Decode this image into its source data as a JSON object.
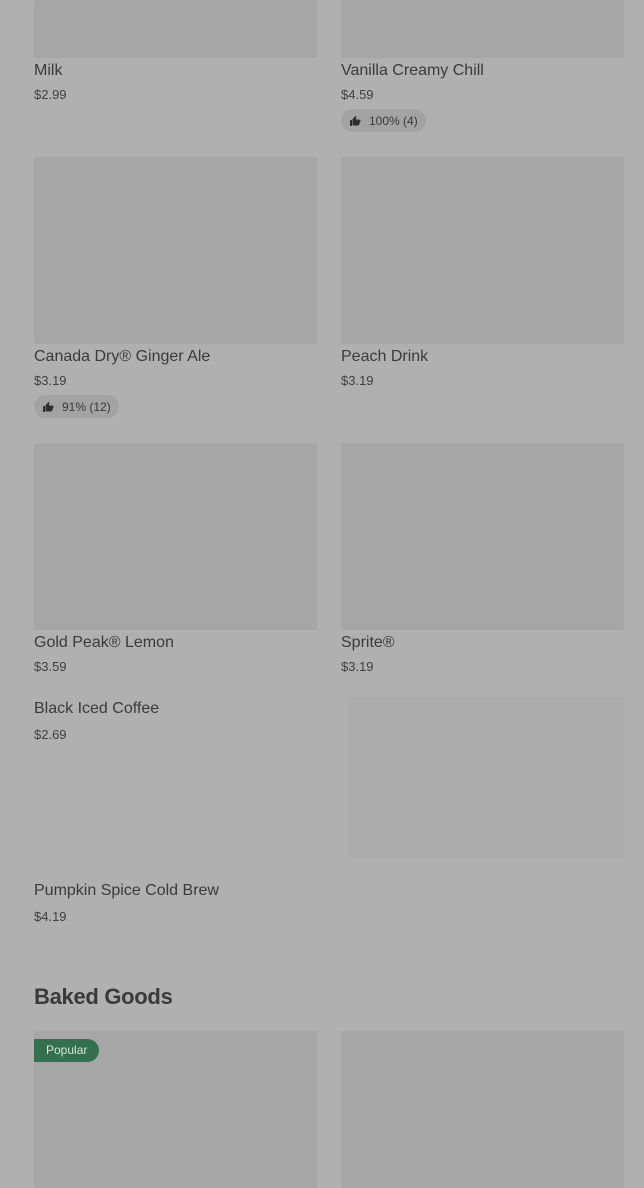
{
  "items": [
    {
      "name": "Milk",
      "price": "$2.99"
    },
    {
      "name": "Vanilla Creamy Chill",
      "price": "$4.59",
      "rating": "100% (4)"
    },
    {
      "name": "Canada Dry® Ginger Ale",
      "price": "$3.19",
      "rating": "91% (12)"
    },
    {
      "name": "Peach Drink",
      "price": "$3.19"
    },
    {
      "name": "Gold Peak® Lemon",
      "price": "$3.59"
    },
    {
      "name": "Sprite®",
      "price": "$3.19"
    },
    {
      "name": "Black Iced Coffee",
      "price": "$2.69"
    },
    {
      "name": "Pumpkin Spice Cold Brew",
      "price": "$4.19"
    }
  ],
  "sections": {
    "baked_goods": {
      "title": "Baked Goods",
      "popular_badge": "Popular"
    }
  },
  "icons": {
    "rating": "thumbs-up-icon"
  }
}
